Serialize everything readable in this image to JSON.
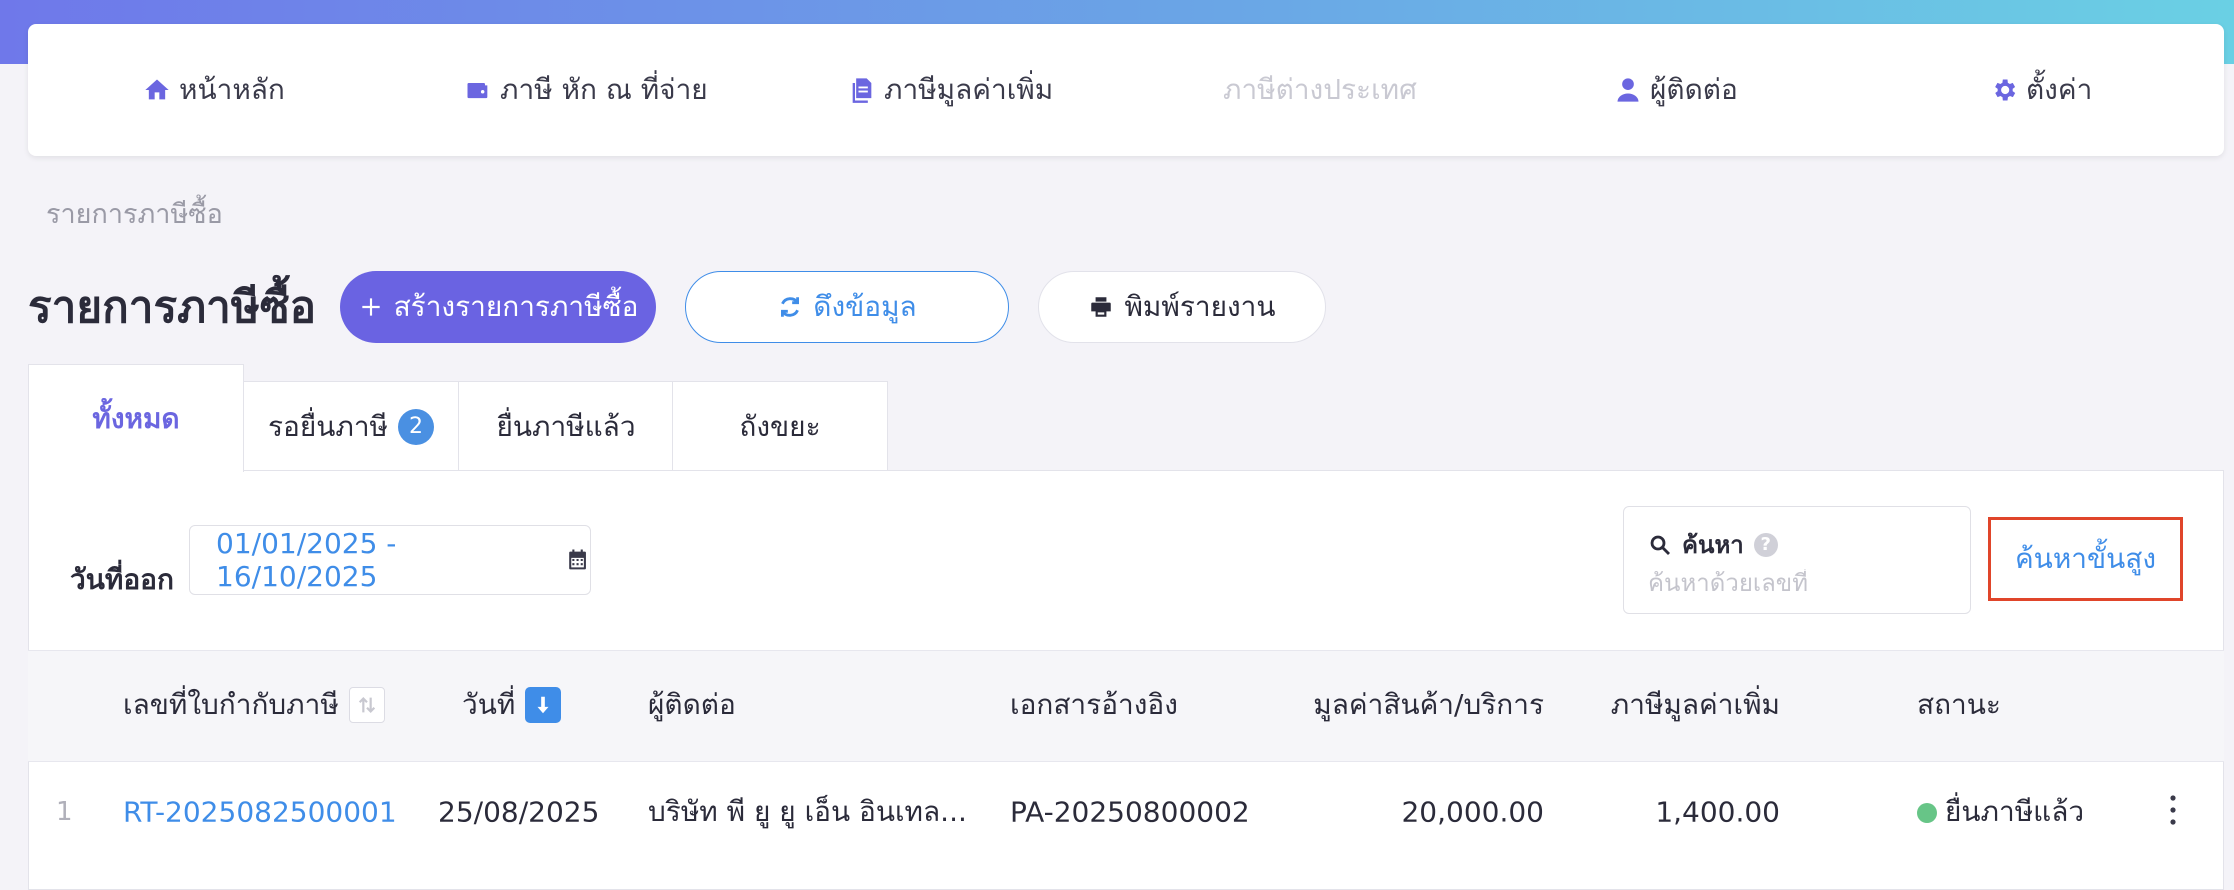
{
  "nav": [
    {
      "label": "หน้าหลัก",
      "icon": "home-icon",
      "disabled": false
    },
    {
      "label": "ภาษี หัก ณ ที่จ่าย",
      "icon": "wallet-icon",
      "disabled": false
    },
    {
      "label": "ภาษีมูลค่าเพิ่ม",
      "icon": "documents-icon",
      "disabled": false
    },
    {
      "label": "ภาษีต่างประเทศ",
      "icon": "",
      "disabled": true
    },
    {
      "label": "ผู้ติดต่อ",
      "icon": "user-icon",
      "disabled": false
    },
    {
      "label": "ตั้งค่า",
      "icon": "gear-icon",
      "disabled": false
    }
  ],
  "breadcrumb": "รายการภาษีซื้อ",
  "page_title": "รายการภาษีซื้อ",
  "actions": {
    "create_label": "สร้างรายการภาษีซื้อ",
    "fetch_label": "ดึงข้อมูล",
    "print_label": "พิมพ์รายงาน"
  },
  "tabs": [
    {
      "label": "ทั้งหมด",
      "active": true
    },
    {
      "label": "รอยื่นภาษี",
      "badge": "2"
    },
    {
      "label": "ยื่นภาษีแล้ว"
    },
    {
      "label": "ถังขยะ"
    }
  ],
  "filter": {
    "date_label": "วันที่ออก",
    "date_range": "01/01/2025 - 16/10/2025"
  },
  "search": {
    "title": "ค้นหา",
    "help": "?",
    "placeholder": "ค้นหาด้วยเลขที่",
    "advanced_label": "ค้นหาขั้นสูง"
  },
  "table": {
    "headers": [
      "เลขที่ใบกำกับภาษี",
      "วันที่",
      "ผู้ติดต่อ",
      "เอกสารอ้างอิง",
      "มูลค่าสินค้า/บริการ",
      "ภาษีมูลค่าเพิ่ม",
      "สถานะ"
    ],
    "rows": [
      {
        "index": "1",
        "tax_invoice_no": "RT-2025082500001",
        "date": "25/08/2025",
        "contact": "บริษัท พี ยู ยู เอ็น อินเทล...",
        "reference": "PA-20250800002",
        "amount": "20,000.00",
        "vat": "1,400.00",
        "status": "ยื่นภาษีแล้ว"
      }
    ]
  },
  "colors": {
    "primary": "#6a63e2",
    "link": "#3f8de8",
    "status_ok": "#67c587",
    "highlight": "#e0452a"
  }
}
